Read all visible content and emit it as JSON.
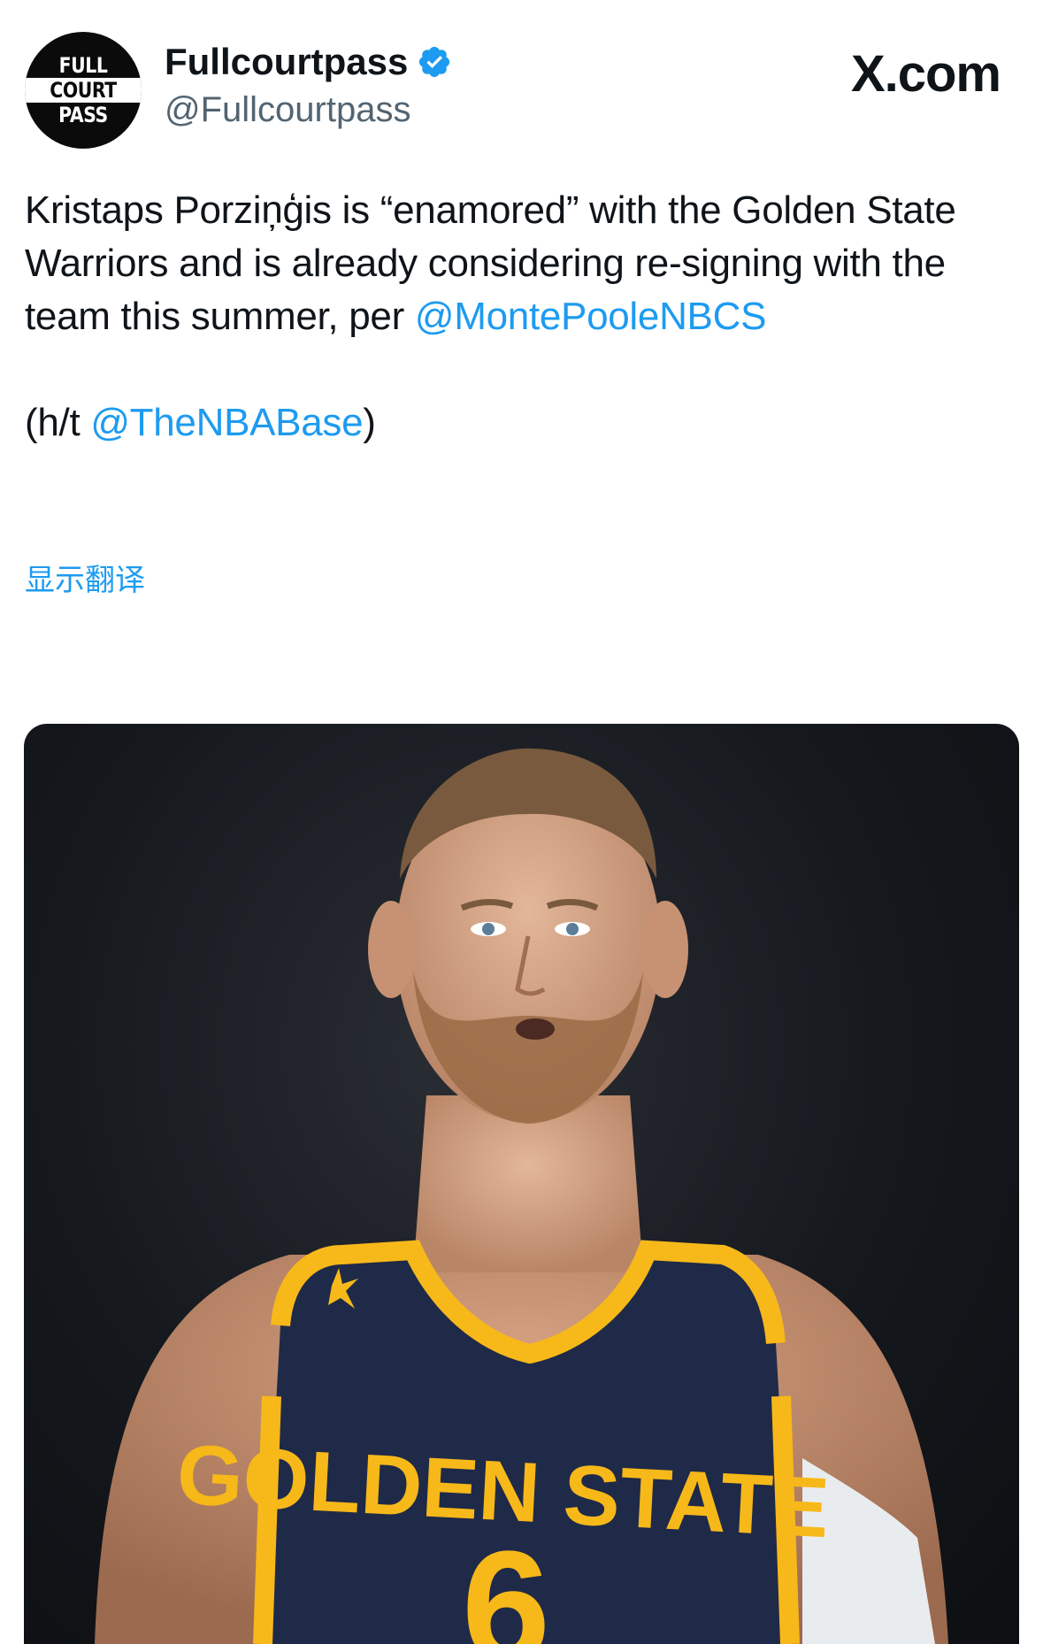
{
  "account": {
    "display_name": "Fullcourtpass",
    "handle": "@Fullcourtpass",
    "verified": true,
    "avatar_text": [
      "FULL",
      "COURT",
      "PASS"
    ]
  },
  "brand": "X.com",
  "tweet": {
    "line_1": "Kristaps Porziņģis is “enamored” with the Golden State Warriors and is already considering re-signing with the team this summer, per",
    "mention_1": "@MontePooleNBCS",
    "hat_tip_prefix": "(h/t ",
    "mention_2": "@TheNBABase",
    "hat_tip_suffix": ")"
  },
  "translate_link": "显示翻译",
  "media": {
    "jersey_text": "GOLDEN STATE",
    "jersey_number": "6"
  },
  "colors": {
    "link": "#1d9bf0",
    "text": "#0f1419",
    "secondary": "#536471",
    "jersey_navy": "#1f2a48",
    "jersey_gold": "#f7b81a"
  },
  "icons": {
    "verified": "verified-badge-icon"
  }
}
